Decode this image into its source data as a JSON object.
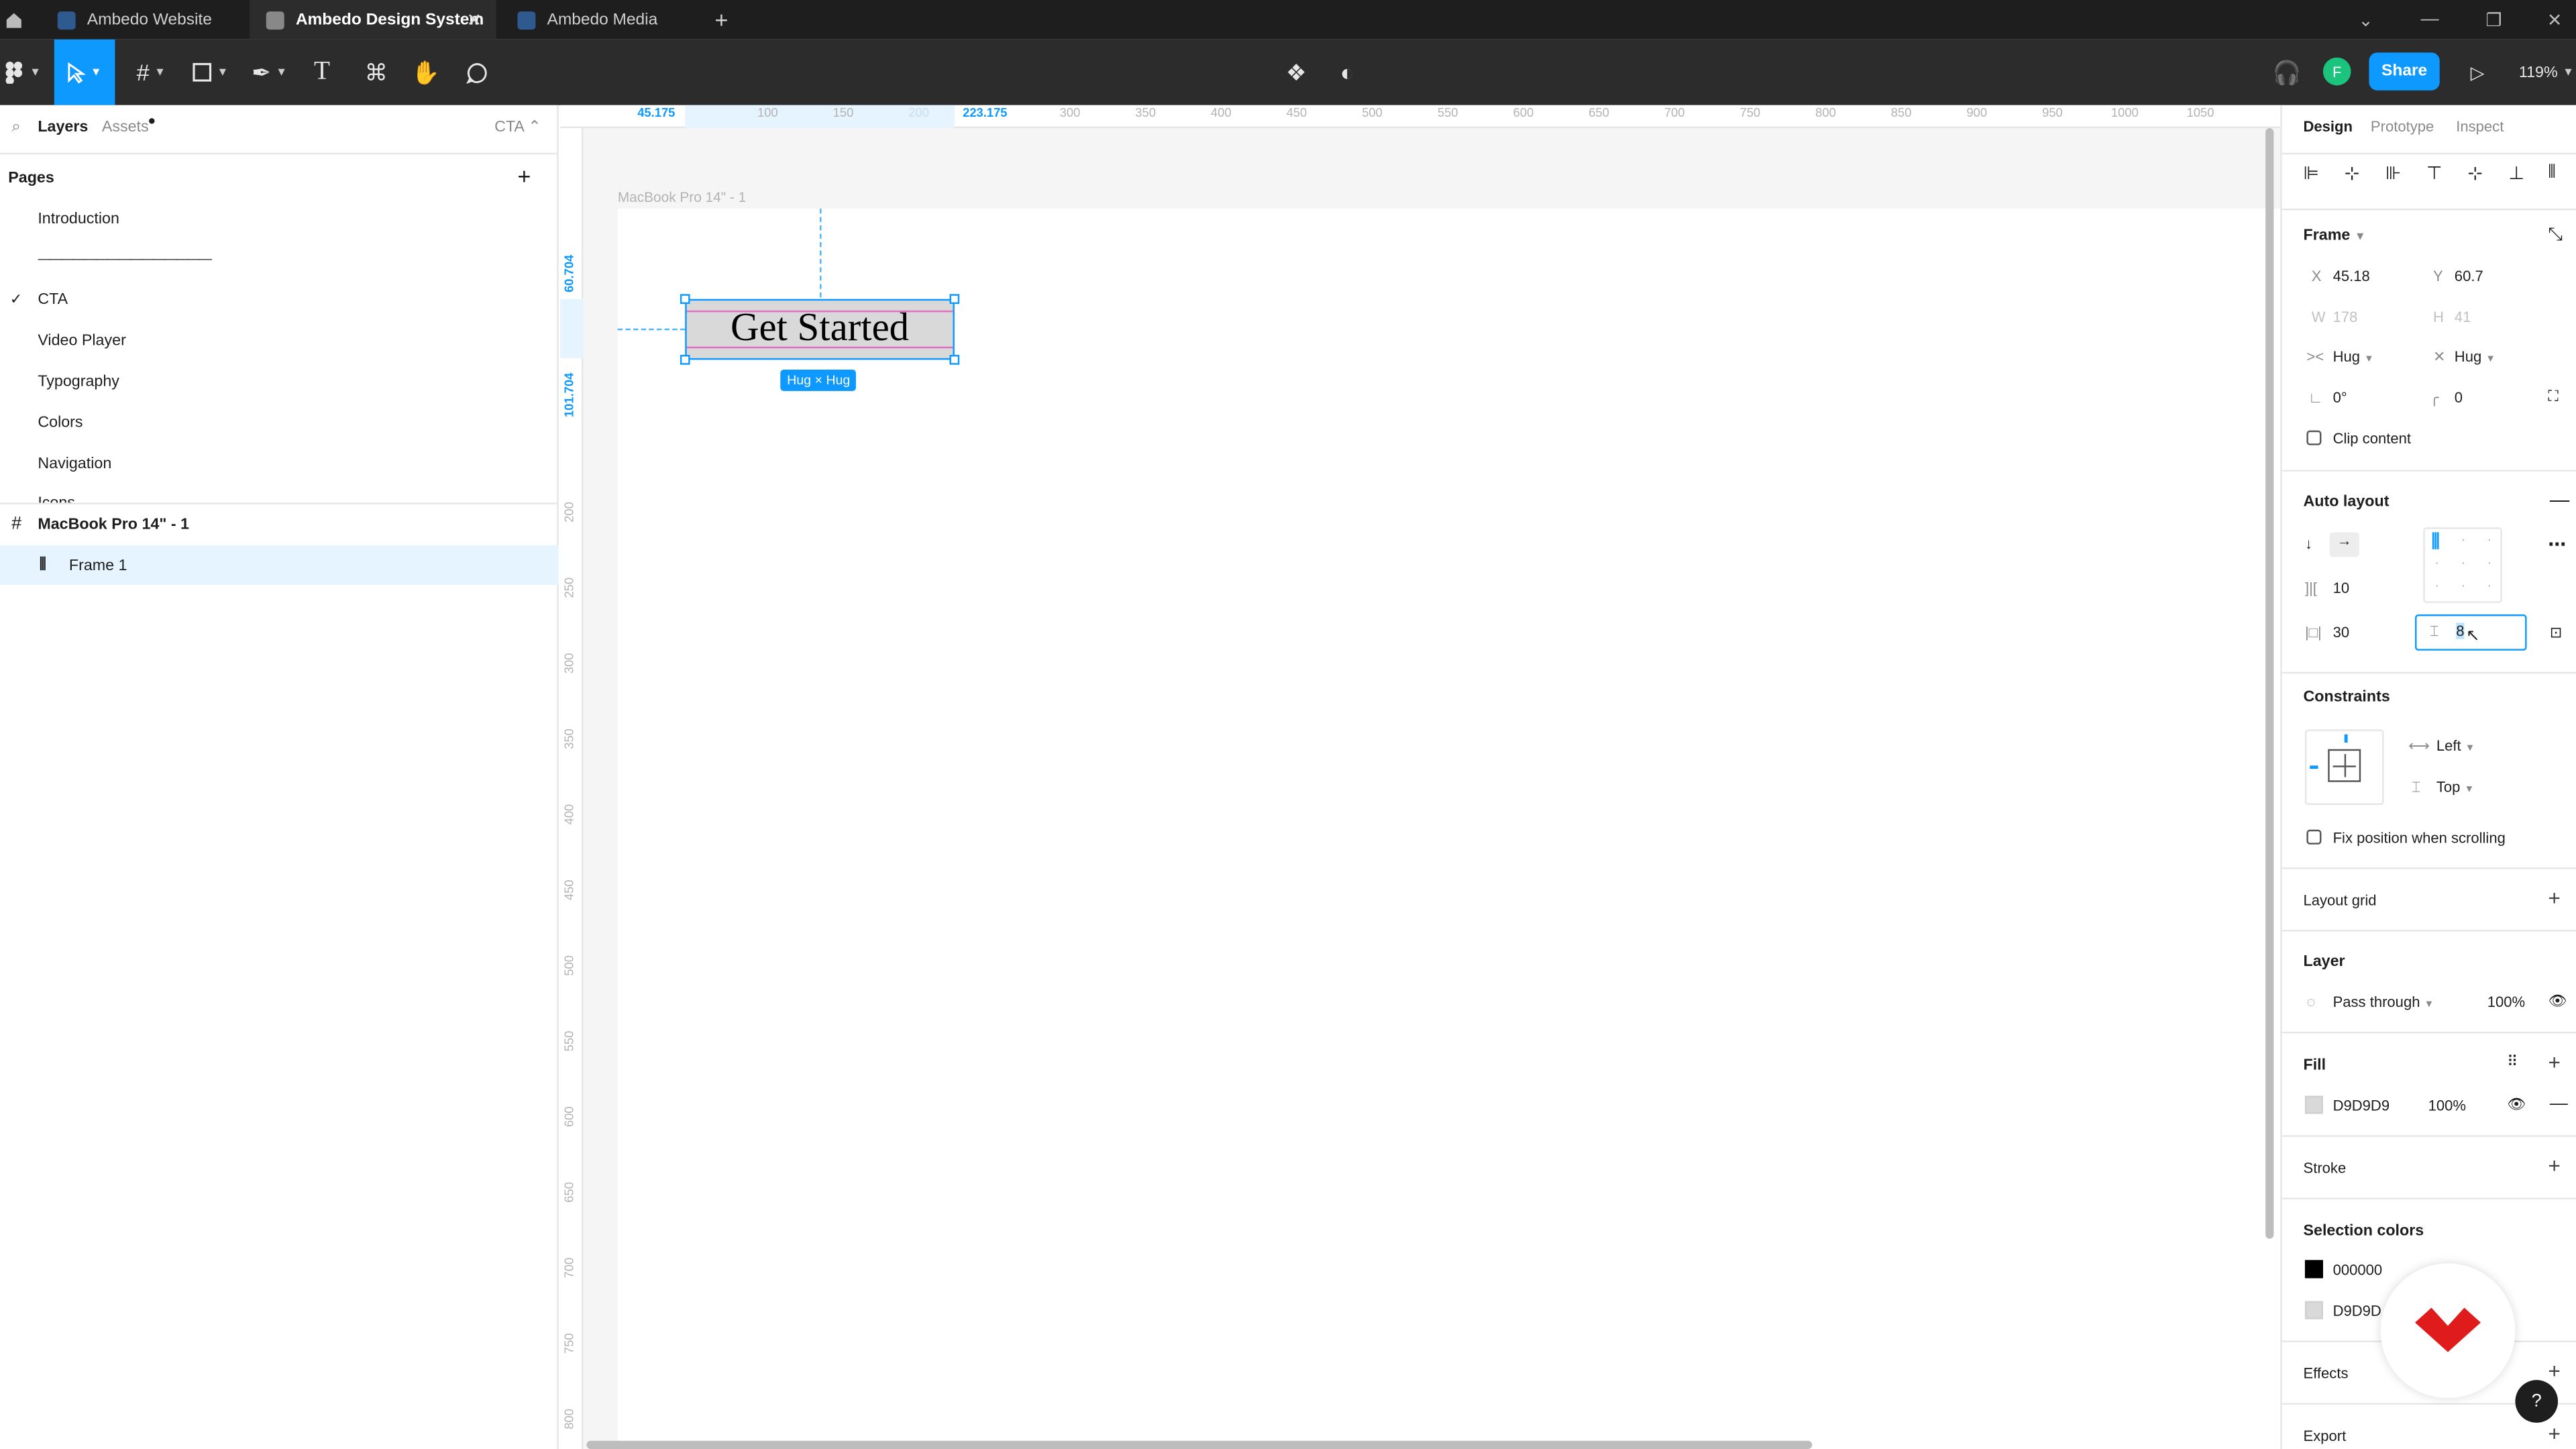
{
  "tabs": [
    {
      "label": "Ambedo Website",
      "active": false
    },
    {
      "label": "Ambedo Design System",
      "active": true
    },
    {
      "label": "Ambedo Media",
      "active": false
    }
  ],
  "toolbar": {
    "share_label": "Share",
    "zoom": "119%",
    "avatar_initial": "F"
  },
  "left": {
    "tab_layers": "Layers",
    "tab_assets": "Assets",
    "page_selector": "CTA",
    "pages_heading": "Pages",
    "pages": [
      "Introduction",
      "———————————————",
      "CTA",
      "Video Player",
      "Typography",
      "Colors",
      "Navigation",
      "Icons"
    ],
    "layers": [
      {
        "label": "MacBook Pro 14\" - 1"
      },
      {
        "label": "Frame 1"
      }
    ]
  },
  "canvas": {
    "frame_label": "MacBook Pro 14\" - 1",
    "button_text": "Get Started",
    "hug_badge": "Hug × Hug",
    "ruler_h_sel_start": "45.175",
    "ruler_h_sel_end": "223.175",
    "ruler_v_sel_start": "60.704",
    "ruler_v_sel_end": "101.704",
    "ruler_h_ticks": [
      "100",
      "150",
      "200",
      "300",
      "350",
      "400",
      "450",
      "500",
      "550",
      "600",
      "650",
      "700",
      "750",
      "800",
      "850",
      "900",
      "950",
      "1000",
      "1050"
    ],
    "ruler_v_ticks": [
      "200",
      "250",
      "300",
      "350",
      "400",
      "450",
      "500",
      "550",
      "600",
      "650",
      "700",
      "750",
      "800"
    ]
  },
  "right": {
    "tabs": [
      "Design",
      "Prototype",
      "Inspect"
    ],
    "frame_heading": "Frame",
    "x_label": "X",
    "x_value": "45.18",
    "y_label": "Y",
    "y_value": "60.7",
    "w_label": "W",
    "w_value": "178",
    "h_label": "H",
    "h_value": "41",
    "hug_w": "Hug",
    "hug_h": "Hug",
    "rotation": "0°",
    "radius": "0",
    "clip_content": "Clip content",
    "auto_layout": "Auto layout",
    "gap": "10",
    "padding_h": "30",
    "padding_v": "8",
    "constraints": "Constraints",
    "constraint_h": "Left",
    "constraint_v": "Top",
    "fix_position": "Fix position when scrolling",
    "layout_grid": "Layout grid",
    "layer_heading": "Layer",
    "blend_mode": "Pass through",
    "layer_opacity": "100%",
    "fill_heading": "Fill",
    "fill_hex": "D9D9D9",
    "fill_opacity": "100%",
    "stroke_heading": "Stroke",
    "selection_colors": "Selection colors",
    "sel_colors": [
      "000000",
      "D9D9D"
    ],
    "effects": "Effects",
    "export": "Export",
    "help": "?"
  },
  "colors": {
    "accent": "#0d99ff",
    "fill": "#D9D9D9",
    "selection": "#000000"
  }
}
